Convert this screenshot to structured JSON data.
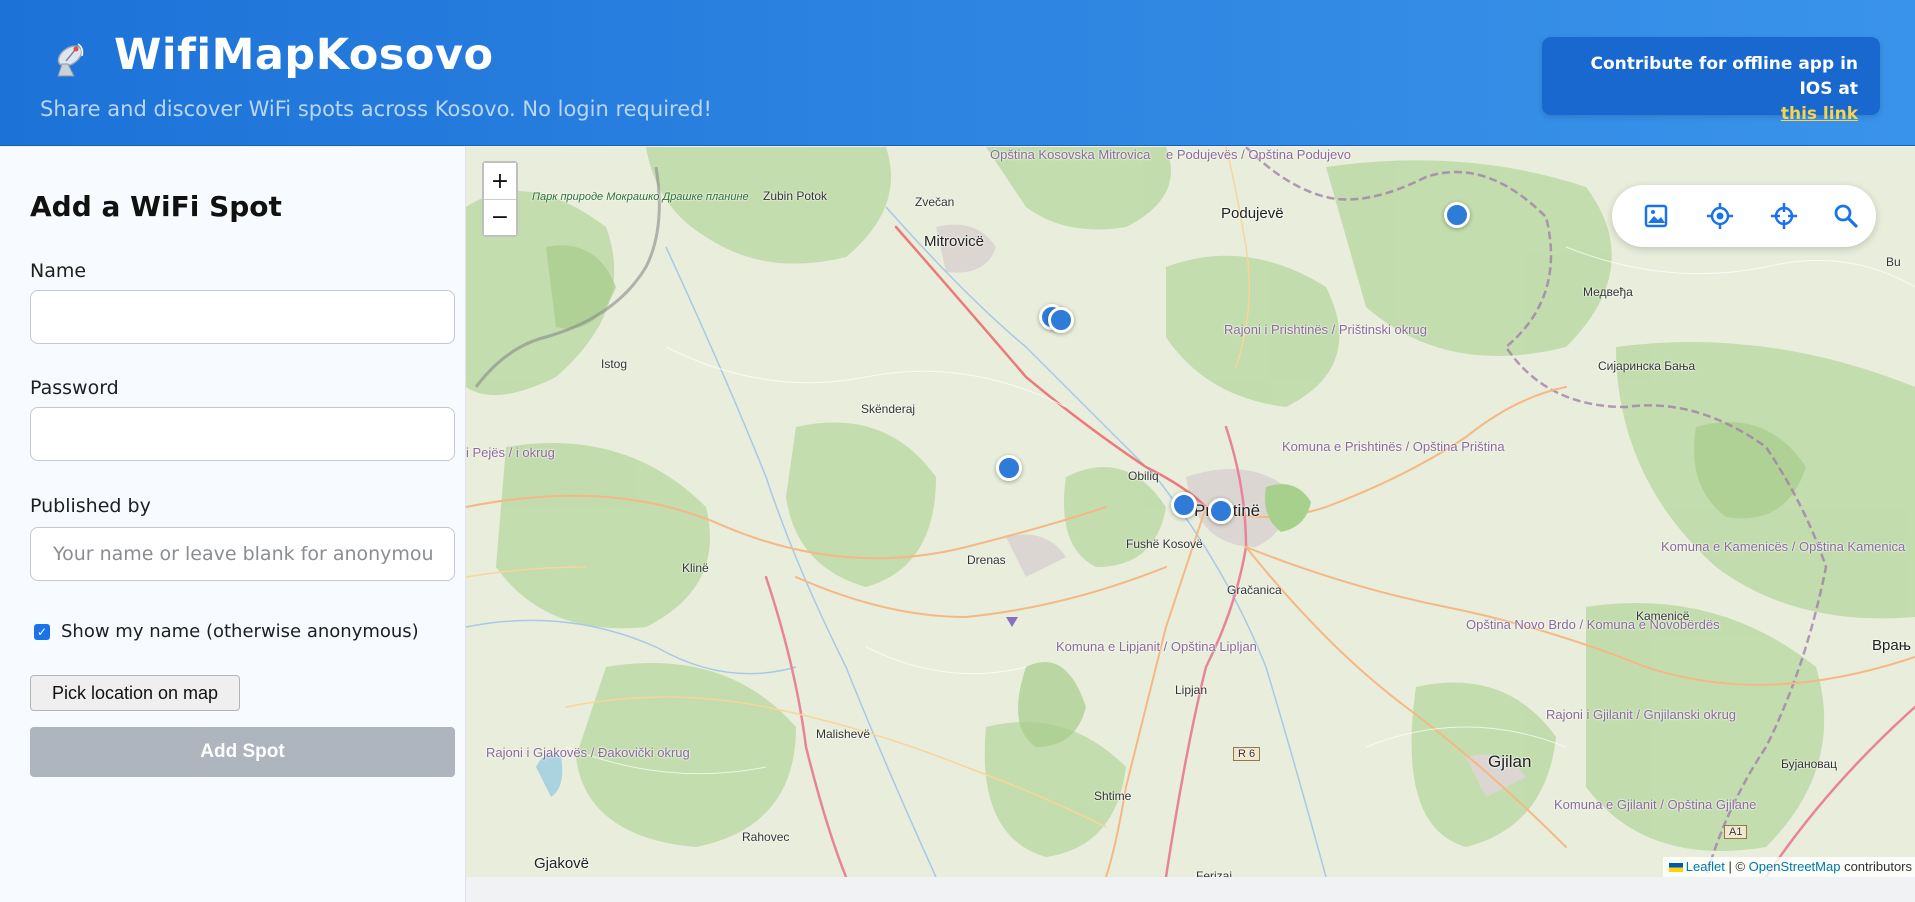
{
  "header": {
    "title": "WifiMapKosovo",
    "subtitle": "Share and discover WiFi spots across Kosovo. No login required!",
    "logo_icon": "satellite-dish-icon",
    "contribute_text": "Contribute for offline app in IOS at",
    "contribute_link": "this link"
  },
  "form": {
    "title": "Add a WiFi Spot",
    "name_label": "Name",
    "name_value": "",
    "password_label": "Password",
    "password_value": "",
    "published_label": "Published by",
    "published_placeholder": "Your name or leave blank for anonymous",
    "show_name_label": "Show my name (otherwise anonymous)",
    "show_name_checked": true,
    "pick_button": "Pick location on map",
    "add_button": "Add Spot"
  },
  "map": {
    "zoom_in": "+",
    "zoom_out": "−",
    "tools": [
      "layers-image-icon",
      "locate-icon",
      "crosshair-icon",
      "search-icon"
    ],
    "places": [
      "Zubin Potok",
      "Zvečan",
      "Mitrovicë",
      "Podujevë",
      "Istog",
      "Skënderaj",
      "Obiliq",
      "Prishtinë",
      "Fushë Kosovë",
      "Drenas",
      "Klinë",
      "Gračanica",
      "Lipjan",
      "Malishevë",
      "Shtime",
      "Rahovec",
      "Gjakovë",
      "Gjilan",
      "Kamenicë",
      "Медвеђа",
      "Сијаринска Бања",
      "Врањ",
      "Бујановац",
      "Ferizaj"
    ],
    "regions": [
      "Rajoni i Prishtinës / Prištinski okrug",
      "Komuna e Prishtinës / Opština Priština",
      "Komuna e Lipjanit / Opština Lipljan",
      "Rajoni i Gjakovës / Đakovički okrug",
      "Rajoni i Gjilanit / Gnjilanski okrug",
      "Komuna e Kamenicës / Opština Kamenica",
      "Opština Novo Brdo / Komuna e Novobërdës",
      "Komuna e Gjilanit / Opština Gjilane",
      "Opština Kosovska Mitrovica",
      "e Podujevës / Opština Podujevo",
      "i Pejës / i okrug",
      "Парк природе Мокрашко Драшке планине"
    ],
    "road_labels": [
      "R 6",
      "A1",
      "Bu"
    ],
    "attribution": {
      "leaflet": "Leaflet",
      "sep": "| ©",
      "osm": "OpenStreetMap",
      "suffix": "contributors"
    },
    "colors": {
      "marker": "#2f7bd8",
      "header_start": "#1d72d8",
      "header_end": "#3a93ea",
      "contribute_bg": "#1868cf",
      "contribute_link": "#f7d44c",
      "add_button_bg": "#aeb5be"
    }
  }
}
